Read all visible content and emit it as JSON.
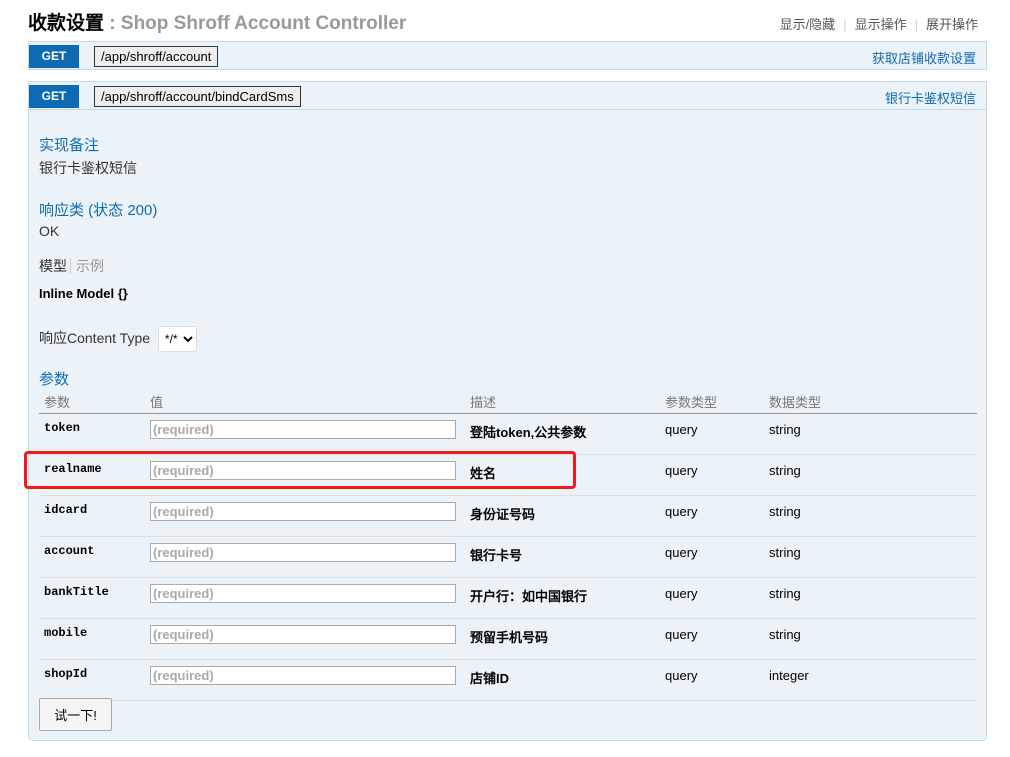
{
  "header": {
    "title_cn": "收款设置",
    "title_sep": " : ",
    "title_en": "Shop Shroff Account Controller",
    "links": [
      "显示/隐藏",
      "显示操作",
      "展开操作"
    ]
  },
  "operations": [
    {
      "method": "GET",
      "path": "/app/shroff/account",
      "summary": "获取店铺收款设置"
    },
    {
      "method": "GET",
      "path": "/app/shroff/account/bindCardSms",
      "summary": "银行卡鉴权短信"
    }
  ],
  "detail": {
    "notes_title": "实现备注",
    "notes_text": "银行卡鉴权短信",
    "response_title": "响应类 (状态 200)",
    "response_text": "OK",
    "tab_model": "模型",
    "tab_example": "示例",
    "inline_model": "Inline Model {}",
    "content_type_label": "响应Content Type",
    "content_type_value": "*/*",
    "params_title": "参数",
    "columns": [
      "参数",
      "值",
      "描述",
      "参数类型",
      "数据类型"
    ],
    "params": [
      {
        "name": "token",
        "placeholder": "(required)",
        "desc": "登陆token,公共参数",
        "ptype": "query",
        "dtype": "string"
      },
      {
        "name": "realname",
        "placeholder": "(required)",
        "desc": "姓名",
        "ptype": "query",
        "dtype": "string"
      },
      {
        "name": "idcard",
        "placeholder": "(required)",
        "desc": "身份证号码",
        "ptype": "query",
        "dtype": "string"
      },
      {
        "name": "account",
        "placeholder": "(required)",
        "desc": "银行卡号",
        "ptype": "query",
        "dtype": "string"
      },
      {
        "name": "bankTitle",
        "placeholder": "(required)",
        "desc": "开户行：如中国银行",
        "ptype": "query",
        "dtype": "string"
      },
      {
        "name": "mobile",
        "placeholder": "(required)",
        "desc": "预留手机号码",
        "ptype": "query",
        "dtype": "string"
      },
      {
        "name": "shopId",
        "placeholder": "(required)",
        "desc": "店铺ID",
        "ptype": "query",
        "dtype": "integer"
      }
    ],
    "try_button": "试一下!"
  },
  "colors": {
    "method_get": "#0f6ab4",
    "op_background": "#ebf3f9",
    "highlight": "#ee1c1c"
  }
}
